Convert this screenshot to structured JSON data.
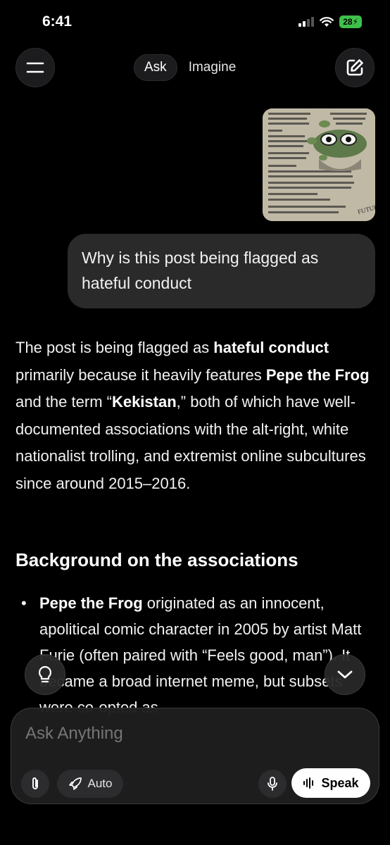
{
  "status_bar": {
    "time": "6:41",
    "battery": "28",
    "icons": [
      "signal-icon",
      "wifi-icon",
      "battery-icon"
    ]
  },
  "header": {
    "tabs": [
      {
        "label": "Ask",
        "selected": true
      },
      {
        "label": "Imagine",
        "selected": false
      }
    ],
    "icons": [
      "menu-icon",
      "compose-icon"
    ]
  },
  "conversation": {
    "user_message": "Why is this post being flagged as hateful conduct",
    "answer": {
      "p1_a": "The post is being flagged as ",
      "p1_b1": "hateful conduct",
      "p1_c": " primarily because it heavily features ",
      "p1_b2": "Pepe the Frog",
      "p1_d": " and the term “",
      "p1_b3": "Kekistan",
      "p1_e": ",” both of which have well-documented associations with the alt-right, white nationalist trolling, and extremist online subcultures since around 2015–2016.",
      "heading": "Background on the associations",
      "bullet_bold": "Pepe the Frog",
      "bullet_text": " originated as an innocent, apolitical comic character in 2005 by artist Matt Furie (often paired with “Feels good, man”). It became a broad internet meme, but subsets were co-opted as"
    }
  },
  "composer": {
    "placeholder": "Ask Anything",
    "auto_label": "Auto",
    "speak_label": "Speak",
    "icons": [
      "paperclip-icon",
      "rocket-icon",
      "mic-icon",
      "waveform-icon",
      "lightbulb-icon",
      "chevron-down-icon"
    ]
  },
  "colors": {
    "background": "#000000",
    "bubble": "#2a2a2a",
    "accent": "#ffffff",
    "battery": "#3ec14a"
  }
}
